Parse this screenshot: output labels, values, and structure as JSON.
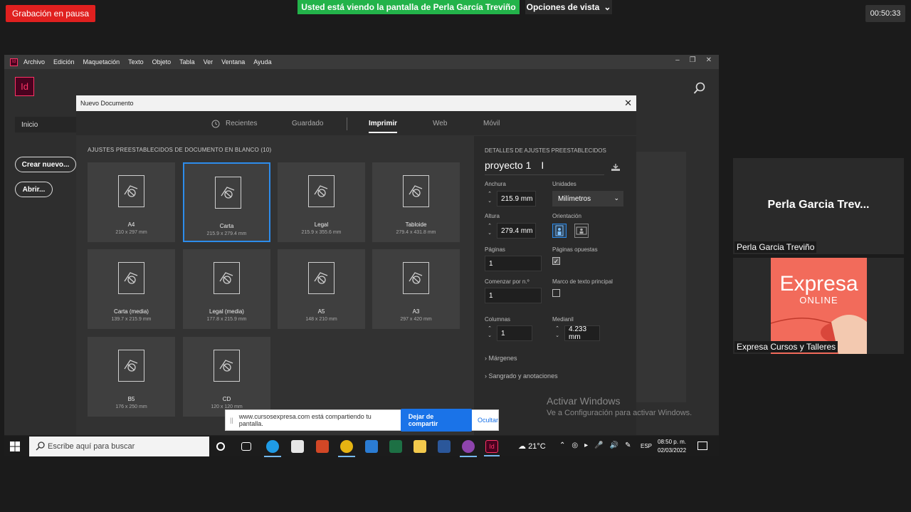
{
  "meeting": {
    "recording_status": "Grabación en pausa",
    "share_banner": "Usted está viendo la pantalla de Perla García Treviño",
    "view_options": "Opciones de vista",
    "timer": "00:50:33",
    "participants": [
      {
        "display": "Perla Garcia Trev...",
        "label": "Perla Garcia Treviño"
      },
      {
        "label": "Expresa Cursos y Talleres",
        "logo_title": "Expresa",
        "logo_sub": "ONLINE"
      }
    ]
  },
  "indesign": {
    "logo": "Id",
    "menu": [
      "Archivo",
      "Edición",
      "Maquetación",
      "Texto",
      "Objeto",
      "Tabla",
      "Ver",
      "Ventana",
      "Ayuda"
    ],
    "window_controls": [
      "–",
      "❐",
      "✕"
    ],
    "home_label": "Inicio",
    "create_new": "Crear nuevo...",
    "open": "Abrir..."
  },
  "dialog": {
    "title": "Nuevo Documento",
    "close": "✕",
    "tabs": {
      "recent": "Recientes",
      "saved": "Guardado",
      "print": "Imprimir",
      "web": "Web",
      "mobile": "Móvil"
    },
    "presets_title": "AJUSTES PREESTABLECIDOS DE DOCUMENTO EN BLANCO",
    "presets_count": "(10)",
    "presets": [
      {
        "name": "A4",
        "size": "210 x 297 mm"
      },
      {
        "name": "Carta",
        "size": "215.9 x 279.4 mm"
      },
      {
        "name": "Legal",
        "size": "215.9 x 355.6 mm"
      },
      {
        "name": "Tabloide",
        "size": "279.4 x 431.8 mm"
      },
      {
        "name": "Carta (media)",
        "size": "139.7 x 215.9 mm"
      },
      {
        "name": "Legal (media)",
        "size": "177.8 x 215.9 mm"
      },
      {
        "name": "A5",
        "size": "148 x 210 mm"
      },
      {
        "name": "A3",
        "size": "297 x 420 mm"
      },
      {
        "name": "B5",
        "size": "176 x 250 mm"
      },
      {
        "name": "CD",
        "size": "120 x 120 mm"
      }
    ],
    "details": {
      "title": "DETALLES DE AJUSTES PREESTABLECIDOS",
      "doc_name": "proyecto 1",
      "width_label": "Anchura",
      "width": "215.9 mm",
      "units_label": "Unidades",
      "units": "Milímetros",
      "height_label": "Altura",
      "height": "279.4 mm",
      "orientation_label": "Orientación",
      "pages_label": "Páginas",
      "pages": "1",
      "facing_label": "Páginas opuestas",
      "facing_checked": "✓",
      "start_label": "Comenzar por n.º",
      "start": "1",
      "primary_frame_label": "Marco de texto principal",
      "columns_label": "Columnas",
      "columns": "1",
      "gutter_label": "Medianil",
      "gutter": "4.233 mm",
      "margins": "Márgenes",
      "bleed": "Sangrado y anotaciones"
    }
  },
  "activate_windows": {
    "line1": "Activar Windows",
    "line2": "Ve a Configuración para activar Windows."
  },
  "sharing_bar": {
    "message": "www.cursosexpresa.com está compartiendo tu pantalla.",
    "stop": "Dejar de compartir",
    "hide": "Ocultar"
  },
  "taskbar": {
    "search_placeholder": "Escribe aquí para buscar",
    "weather": "21°C",
    "lang": "ESP",
    "time": "08:50 p. m.",
    "date": "02/03/2022"
  }
}
